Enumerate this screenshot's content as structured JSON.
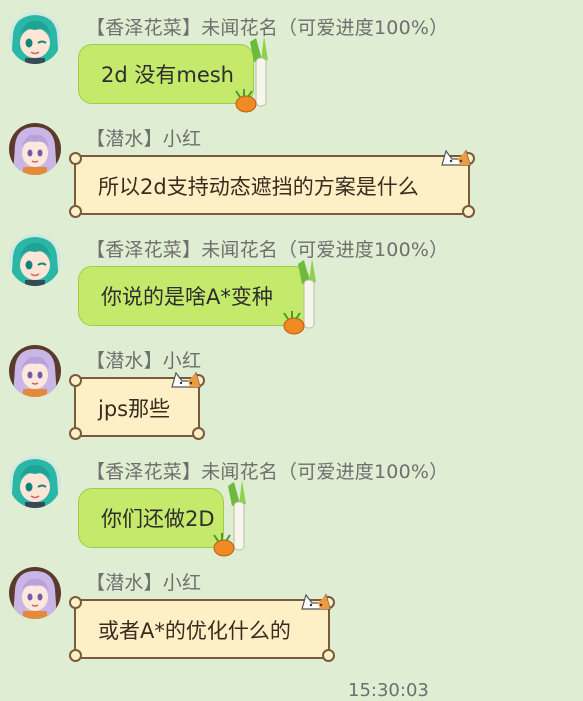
{
  "messages": [
    {
      "sender": "【香泽花菜】未闻花名（可爱进度100%）",
      "text": "2d 没有mesh",
      "style": "green",
      "avatar": "miku-avatar"
    },
    {
      "sender": "【潜水】小红",
      "text": "所以2d支持动态遮挡的方案是什么",
      "style": "scroll",
      "avatar": "lavender-hair-avatar"
    },
    {
      "sender": "【香泽花菜】未闻花名（可爱进度100%）",
      "text": "你说的是啥A*变种",
      "style": "green",
      "avatar": "miku-avatar"
    },
    {
      "sender": "【潜水】小红",
      "text": "jps那些",
      "style": "scroll",
      "avatar": "lavender-hair-avatar"
    },
    {
      "sender": "【香泽花菜】未闻花名（可爱进度100%）",
      "text": "你们还做2D",
      "style": "green",
      "avatar": "miku-avatar"
    },
    {
      "sender": "【潜水】小红",
      "text": "或者A*的优化什么的",
      "style": "scroll",
      "avatar": "lavender-hair-avatar"
    }
  ],
  "timestamp": "15:30:03",
  "colors": {
    "background": "#dfeed2",
    "green_bubble": "#c5e96b",
    "scroll_bubble": "#fdf0c6",
    "sender_text": "#6f6f6f"
  }
}
